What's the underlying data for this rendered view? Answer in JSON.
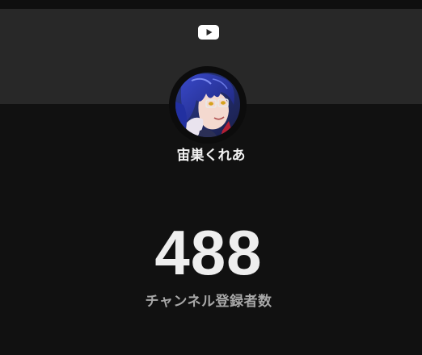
{
  "header": {
    "icon": "youtube-play-icon",
    "banner_color": "#282828"
  },
  "channel": {
    "name": "宙巣くれあ",
    "avatar": "channel-avatar"
  },
  "stats": {
    "subscriber_count": "488",
    "subscriber_label": "チャンネル登録者数"
  },
  "colors": {
    "background": "#111111",
    "count_text": "#eeeeee",
    "label_text": "#a8a8a8"
  }
}
